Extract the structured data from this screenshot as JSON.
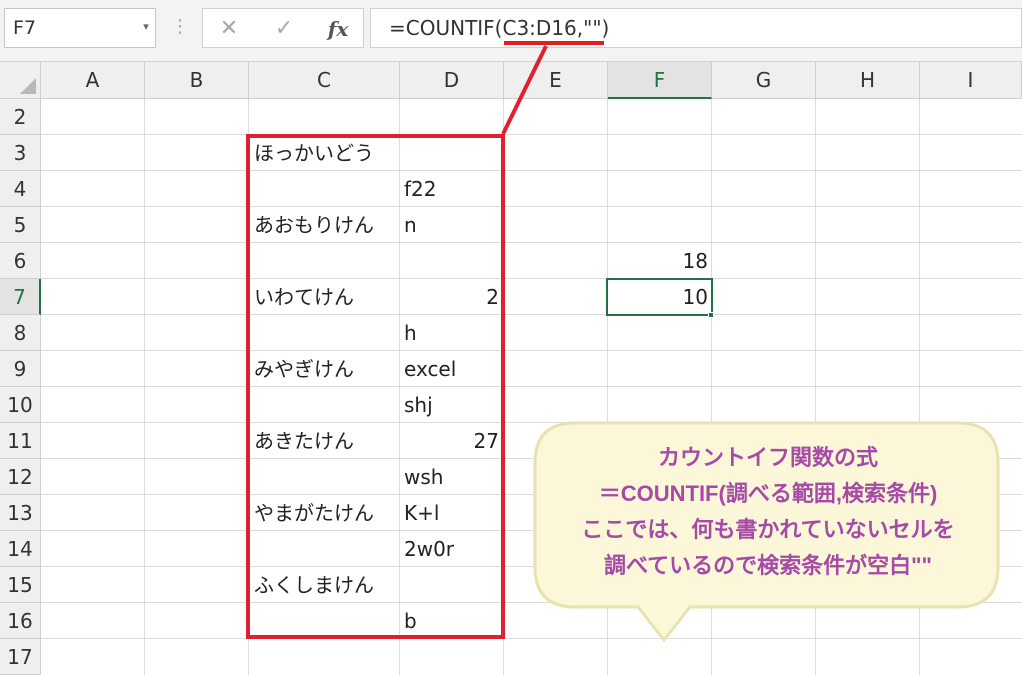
{
  "formula_bar": {
    "name_box": "F7",
    "cancel_glyph": "✕",
    "enter_glyph": "✓",
    "fx_label": "fx",
    "formula": "=COUNTIF(C3:D16,\"\")"
  },
  "columns": [
    "A",
    "B",
    "C",
    "D",
    "E",
    "F",
    "G",
    "H",
    "I"
  ],
  "active_column": "F",
  "rows": [
    "2",
    "3",
    "4",
    "5",
    "6",
    "7",
    "8",
    "9",
    "10",
    "11",
    "12",
    "13",
    "14",
    "15",
    "16",
    "17"
  ],
  "active_row": "7",
  "cells": {
    "C3": "ほっかいどう",
    "D4": "f22",
    "C5": "あおもりけん",
    "D5": "n",
    "F6": "18",
    "C7": "いわてけん",
    "D7": "2",
    "F7": "10",
    "D8": "h",
    "C9": "みやぎけん",
    "D9": "excel",
    "D10": "shj",
    "C11": "あきたけん",
    "D11": "27",
    "D12": "wsh",
    "C13": "やまがたけん",
    "D13": "K+l",
    "D14": "2w0r",
    "C15": "ふくしまけん",
    "D16": "b"
  },
  "callout": {
    "lines": [
      "カウントイフ関数の式",
      "＝COUNTIF(調べる範囲,検索条件)",
      "ここでは、何も書かれていないセルを",
      "調べているので検索条件が空白\"\""
    ]
  },
  "colors": {
    "highlight_red": "#e02030",
    "excel_green": "#217346",
    "callout_text": "#a64aa7",
    "callout_fill": "#fbf7d8",
    "callout_border": "#e8e2b0"
  }
}
